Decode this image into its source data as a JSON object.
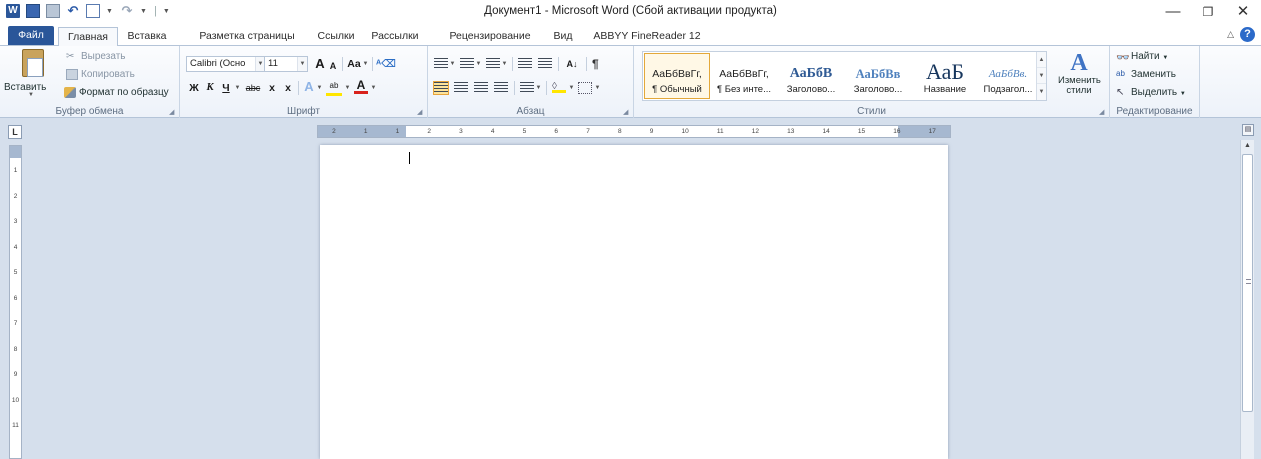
{
  "window": {
    "title": "Документ1 - Microsoft Word (Сбой активации продукта)",
    "minimize": "—",
    "restore": "❐",
    "close": "✕"
  },
  "tabs": [
    {
      "label": "Файл"
    },
    {
      "label": "Главная"
    },
    {
      "label": "Вставка"
    },
    {
      "label": "Разметка страницы"
    },
    {
      "label": "Ссылки"
    },
    {
      "label": "Рассылки"
    },
    {
      "label": "Рецензирование"
    },
    {
      "label": "Вид"
    },
    {
      "label": "ABBYY FineReader 12"
    }
  ],
  "help": "?",
  "clipboard": {
    "paste": "Вставить",
    "cut": "Вырезать",
    "copy": "Копировать",
    "format_painter": "Формат по образцу",
    "group_label": "Буфер обмена"
  },
  "font": {
    "font_name": "Calibri (Осно",
    "font_size": "11",
    "grow": "A",
    "shrink": "A",
    "case": "Aa",
    "bold": "Ж",
    "italic": "К",
    "underline": "Ч",
    "strike": "abc",
    "subscript": "x",
    "superscript": "x",
    "group_label": "Шрифт"
  },
  "paragraph": {
    "show_marks": "¶",
    "sort": "А↓",
    "group_label": "Абзац"
  },
  "styles": {
    "items": [
      {
        "sample": "АаБбВвГг,",
        "name": "¶ Обычный"
      },
      {
        "sample": "АаБбВвГг,",
        "name": "¶ Без инте..."
      },
      {
        "sample": "АаБбВ",
        "name": "Заголово..."
      },
      {
        "sample": "АаБбВв",
        "name": "Заголово..."
      },
      {
        "sample": "АаБ",
        "name": "Название"
      },
      {
        "sample": "АаБбВв.",
        "name": "Подзагол..."
      }
    ],
    "change_styles": "Изменить стили",
    "group_label": "Стили"
  },
  "editing": {
    "find": "Найти",
    "replace": "Заменить",
    "select": "Выделить",
    "group_label": "Редактирование"
  },
  "ruler": {
    "corner": "L",
    "h_ticks": [
      "2",
      "1",
      "1",
      "2",
      "3",
      "4",
      "5",
      "6",
      "7",
      "8",
      "9",
      "10",
      "11",
      "12",
      "13",
      "14",
      "15",
      "16",
      "17"
    ],
    "v_ticks": [
      "1",
      "2",
      "3",
      "4",
      "5",
      "6",
      "7",
      "8",
      "9",
      "10",
      "11"
    ]
  }
}
